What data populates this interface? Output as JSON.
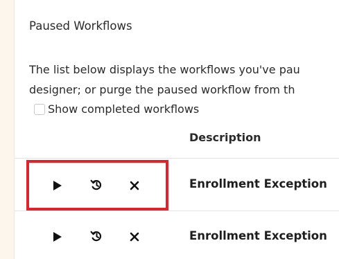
{
  "page": {
    "title": "Paused Workflows",
    "description_lines": [
      "The list below displays the workflows you've pau",
      "designer; or purge the paused workflow from th"
    ],
    "show_completed_label": "Show completed workflows",
    "show_completed_checked": false
  },
  "table": {
    "columns": {
      "description": "Description"
    },
    "rows": [
      {
        "description": "Enrollment Exception",
        "highlighted": true
      },
      {
        "description": "Enrollment Exception",
        "highlighted": false
      }
    ]
  },
  "icons": {
    "resume": "play-icon",
    "history": "history-icon",
    "purge": "close-icon"
  },
  "colors": {
    "highlight": "#e0232b",
    "background": "#fdf6ec"
  }
}
